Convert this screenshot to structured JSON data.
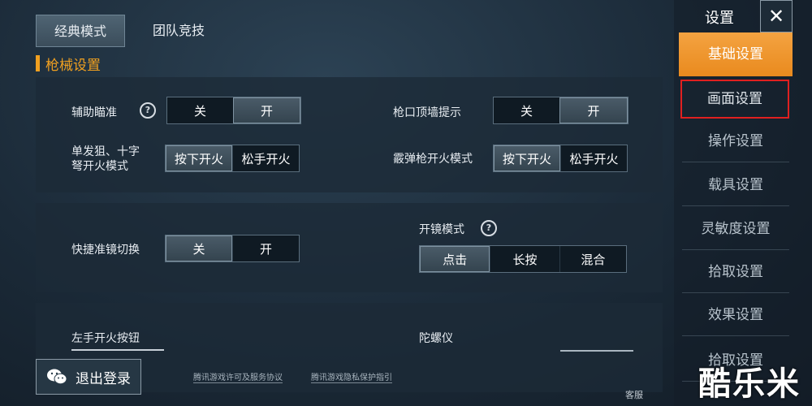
{
  "tabs": {
    "classic": "经典模式",
    "team": "团队竞技"
  },
  "section_title": "枪械设置",
  "settings": {
    "aim_assist": {
      "label": "辅助瞄准",
      "options": [
        "关",
        "开"
      ],
      "selected": "开"
    },
    "muzzle_wall": {
      "label": "枪口顶墙提示",
      "options": [
        "关",
        "开"
      ],
      "selected": "开"
    },
    "single_fire": {
      "label_line1": "单发狙、十字",
      "label_line2": "弩开火模式",
      "options": [
        "按下开火",
        "松手开火"
      ],
      "selected": "按下开火"
    },
    "shotgun_fire": {
      "label": "霰弹枪开火模式",
      "options": [
        "按下开火",
        "松手开火"
      ],
      "selected": "按下开火"
    },
    "quick_scope": {
      "label": "快捷准镜切换",
      "options": [
        "关",
        "开"
      ],
      "selected": "关"
    },
    "scope_mode": {
      "label": "开镜模式",
      "options": [
        "点击",
        "长按",
        "混合"
      ],
      "selected": "点击"
    },
    "left_fire": {
      "label": "左手开火按钮"
    },
    "gyroscope": {
      "label": "陀螺仪"
    }
  },
  "footer": {
    "logout_label": "退出登录",
    "license_link": "腾讯游戏许可及服务协议",
    "privacy_link": "腾讯游戏隐私保护指引",
    "service": "客服"
  },
  "sidebar": {
    "title": "设置",
    "close_icon": "close-icon",
    "items": [
      "基础设置",
      "画面设置",
      "操作设置",
      "载具设置",
      "灵敏度设置",
      "拾取设置",
      "效果设置",
      "拾取设置"
    ],
    "active_index": 0,
    "highlight_index": 1
  },
  "watermark": "酷乐米",
  "colors": {
    "accent": "#f0a020",
    "highlight_border": "#e02020"
  }
}
